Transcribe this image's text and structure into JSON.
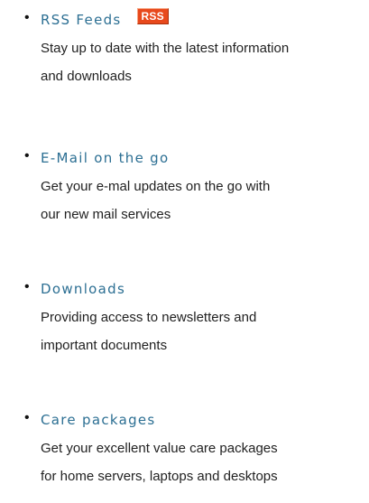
{
  "items": [
    {
      "title": "RSS Feeds",
      "badge": "RSS",
      "description": [
        "Stay up to date with the latest information",
        "and downloads"
      ]
    },
    {
      "title": "E-Mail on the go",
      "description": [
        "Get your e-mal updates on the go with",
        "our new mail services"
      ]
    },
    {
      "title": "Downloads",
      "description": [
        "Providing access to newsletters and",
        "important documents"
      ]
    },
    {
      "title": "Care packages",
      "description": [
        "Get your excellent value care packages",
        "for home servers, laptops and desktops"
      ]
    }
  ],
  "colors": {
    "title": "#2c6f93",
    "text": "#222222",
    "rss_badge": "#e8491c"
  }
}
